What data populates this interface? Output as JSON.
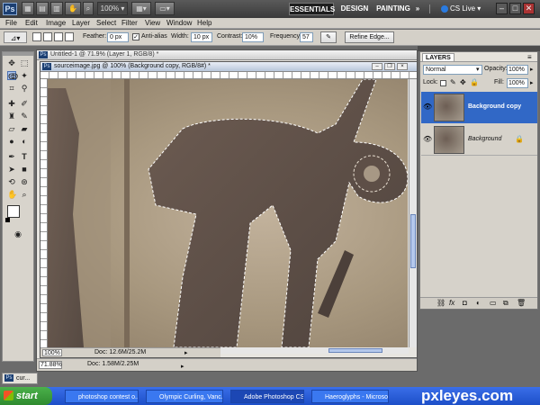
{
  "app": {
    "logo": "Ps",
    "zoom": "100%",
    "workspaces": [
      "ESSENTIALS",
      "DESIGN",
      "PAINTING"
    ],
    "more": "»",
    "cslive": "CS Live",
    "winctl": [
      "–",
      "□",
      "✕"
    ]
  },
  "menu": [
    "File",
    "Edit",
    "Image",
    "Layer",
    "Select",
    "Filter",
    "View",
    "Window",
    "Help"
  ],
  "options": {
    "feather_label": "Feather:",
    "feather_value": "0 px",
    "antialias_label": "Anti-alias",
    "width_label": "Width:",
    "width_value": "10 px",
    "contrast_label": "Contrast:",
    "contrast_value": "10%",
    "frequency_label": "Frequency:",
    "frequency_value": "57",
    "refine_edge": "Refine Edge..."
  },
  "docs": {
    "bg_title": "Untitled-1 @ 71.9% (Layer 1, RGB/8) *",
    "main_title": "sourceimage.jpg @ 100% (Background copy, RGB/8#) *",
    "main_zoom": "100%",
    "main_docsize": "Doc: 12.6M/25.2M",
    "bg_zoom": "71.88%",
    "bg_docsize": "Doc: 1.58M/2.25M"
  },
  "layers": {
    "tab": "LAYERS",
    "blend_mode": "Normal",
    "opacity_label": "Opacity:",
    "opacity_value": "100%",
    "lock_label": "Lock:",
    "fill_label": "Fill:",
    "fill_value": "100%",
    "items": [
      {
        "name": "Background copy",
        "selected": true
      },
      {
        "name": "Background",
        "selected": false
      }
    ]
  },
  "minimized": "cur...",
  "taskbar": {
    "start": "start",
    "tasks": [
      "photoshop contest o...",
      "Olympic Curling, Vanc...",
      "Adobe Photoshop CS5",
      "Haeroglyphs - Microso..."
    ],
    "watermark": "pxleyes.com"
  }
}
